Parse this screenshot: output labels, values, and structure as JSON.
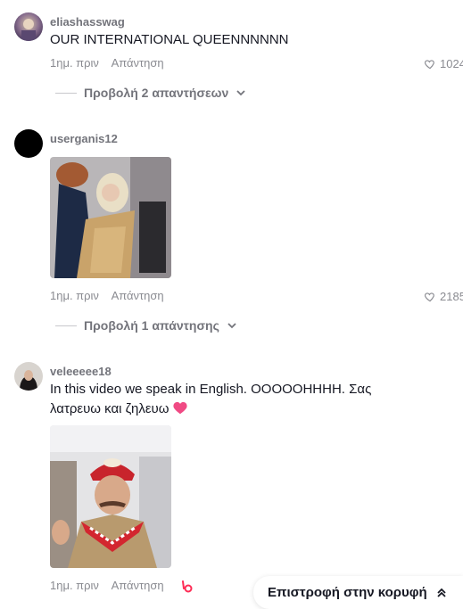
{
  "comments": [
    {
      "username": "eliashasswag",
      "text": "OUR INTERNATIONAL QUEENNNNNN",
      "time": "1ημ. πριν",
      "reply_label": "Απάντηση",
      "likes": "1024",
      "view_replies": "Προβολή 2 απαντήσεων"
    },
    {
      "username": "userganis12",
      "time": "1ημ. πριν",
      "reply_label": "Απάντηση",
      "likes": "2185",
      "view_replies": "Προβολή 1 απάντησης"
    },
    {
      "username": "veleeeee18",
      "text": "In this video we speak in English. OOOOOHHHH. Σας λατρευω και ζηλευω",
      "time": "1ημ. πριν",
      "reply_label": "Απάντηση"
    }
  ],
  "back_to_top": "Επιστροφή στην κορυφή",
  "colors": {
    "text": "#161823",
    "muted": "#8a8b91",
    "accent": "#fe2c55"
  }
}
